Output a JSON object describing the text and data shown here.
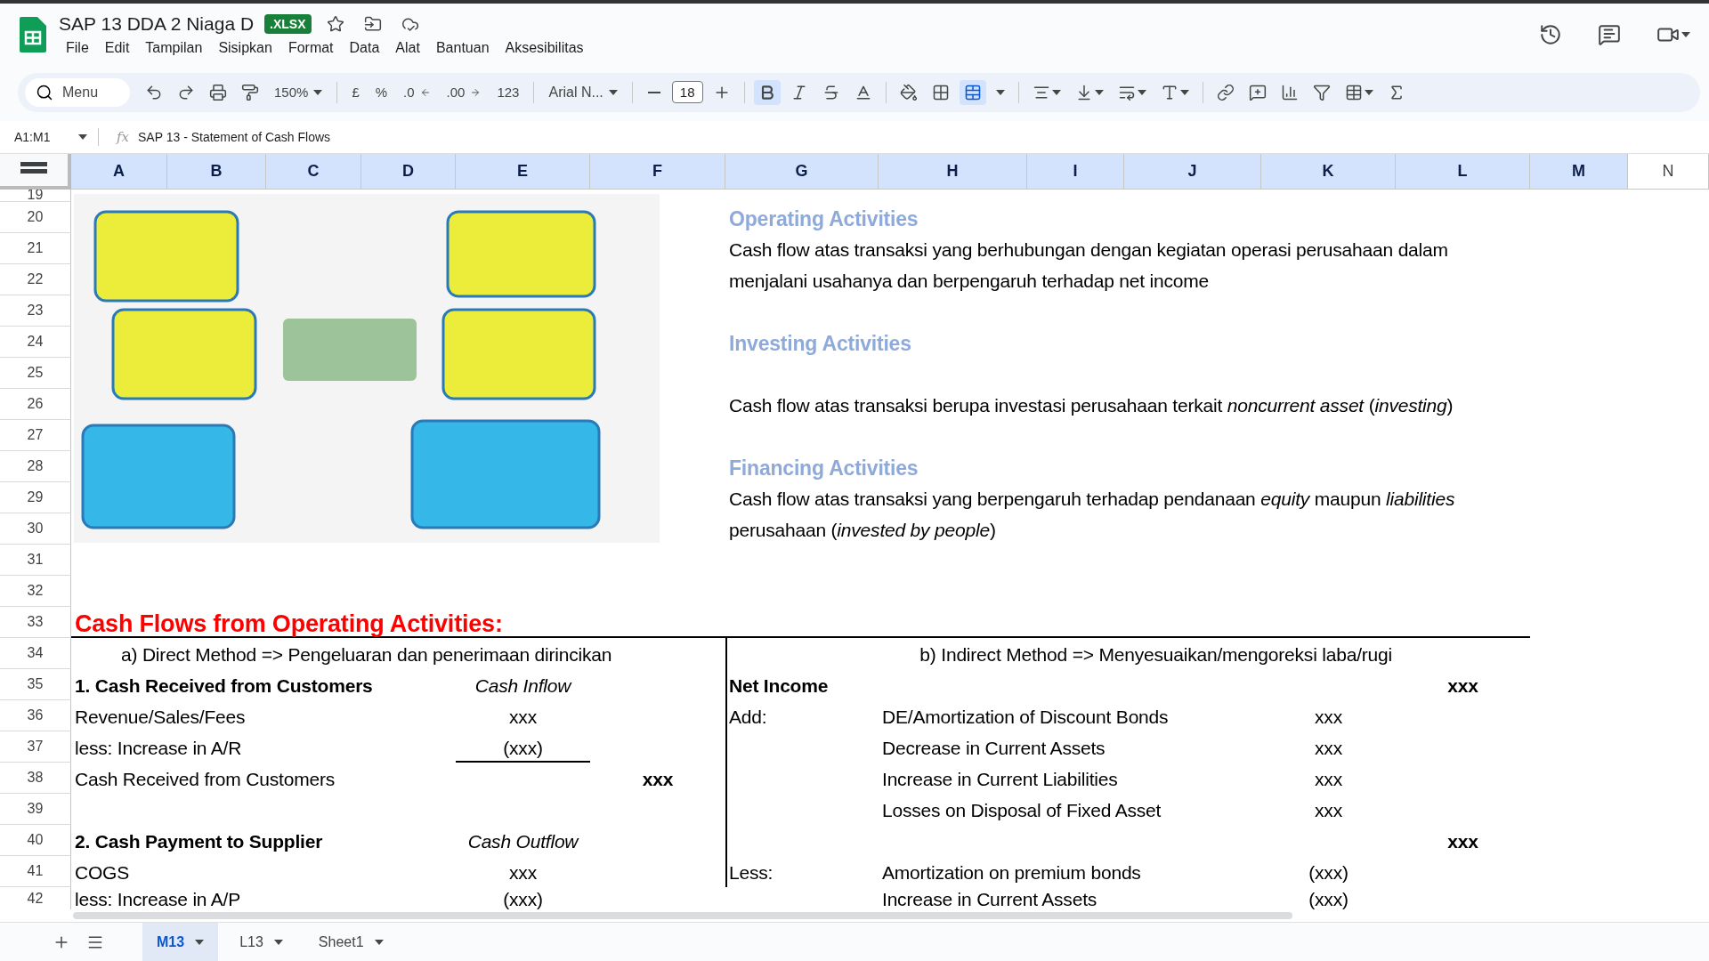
{
  "document": {
    "title": "SAP 13 DDA 2 Niaga D",
    "badge": ".XLSX",
    "starred": false
  },
  "menu": [
    "File",
    "Edit",
    "Tampilan",
    "Sisipkan",
    "Format",
    "Data",
    "Alat",
    "Bantuan",
    "Aksesibilitas"
  ],
  "toolbar": {
    "search_placeholder": "Menu",
    "zoom": "150%",
    "currency": "£",
    "percent": "%",
    "decrease_decimals": ".0",
    "increase_decimals": ".00",
    "number_format": "123",
    "font": "Arial N...",
    "font_size": "18",
    "bold_active": true,
    "merge_active": true
  },
  "formula_bar": {
    "name_box": "A1:M1",
    "fx": "fx",
    "formula": "SAP 13 - Statement of Cash Flows"
  },
  "columns": [
    {
      "label": "A",
      "selected": true
    },
    {
      "label": "B",
      "selected": true
    },
    {
      "label": "C",
      "selected": true
    },
    {
      "label": "D",
      "selected": true
    },
    {
      "label": "E",
      "selected": true
    },
    {
      "label": "F",
      "selected": true
    },
    {
      "label": "G",
      "selected": true
    },
    {
      "label": "H",
      "selected": true
    },
    {
      "label": "I",
      "selected": true
    },
    {
      "label": "J",
      "selected": true
    },
    {
      "label": "K",
      "selected": true
    },
    {
      "label": "L",
      "selected": true
    },
    {
      "label": "M",
      "selected": true
    },
    {
      "label": "N",
      "selected": false
    }
  ],
  "rows": [
    {
      "number": "19",
      "cells": {}
    },
    {
      "number": "20",
      "cells": {
        "G": {
          "kind": "heading",
          "text": "Operating Activities"
        }
      }
    },
    {
      "number": "21",
      "cells": {
        "G": {
          "kind": "text",
          "text": "Cash flow atas transaksi yang berhubungan dengan kegiatan operasi perusahaan dalam"
        }
      }
    },
    {
      "number": "22",
      "cells": {
        "G": {
          "kind": "text",
          "text": "menjalani usahanya dan berpengaruh terhadap net income"
        }
      }
    },
    {
      "number": "23",
      "cells": {}
    },
    {
      "number": "24",
      "cells": {
        "G": {
          "kind": "heading",
          "text": "Investing Activities"
        }
      }
    },
    {
      "number": "25",
      "cells": {}
    },
    {
      "number": "26",
      "cells": {
        "G": {
          "kind": "text",
          "text": "Cash flow atas transaksi berupa investasi perusahaan terkait *noncurrent asset* (*investing*)"
        }
      }
    },
    {
      "number": "27",
      "cells": {}
    },
    {
      "number": "28",
      "cells": {
        "G": {
          "kind": "heading",
          "text": "Financing Activities"
        }
      }
    },
    {
      "number": "29",
      "cells": {
        "G": {
          "kind": "text",
          "text": "Cash flow atas transaksi yang berpengaruh terhadap pendanaan *equity* maupun *liabilities*"
        }
      }
    },
    {
      "number": "30",
      "cells": {
        "G": {
          "kind": "text",
          "text": "perusahaan (*invested by people*)"
        }
      }
    },
    {
      "number": "31",
      "cells": {}
    },
    {
      "number": "32",
      "cells": {}
    },
    {
      "number": "33",
      "cells": {
        "A": {
          "kind": "title",
          "text": "Cash Flows from Operating Activities:"
        }
      }
    },
    {
      "number": "34",
      "cells": {
        "A": {
          "kind": "subheading",
          "text": "a) Direct Method => Pengeluaran dan penerimaan dirincikan"
        },
        "G": {
          "kind": "subheading-right",
          "text": "b) Indirect Method => Menyesuaikan/mengoreksi laba/rugi"
        }
      }
    },
    {
      "number": "35",
      "cells": {
        "A": {
          "kind": "bold",
          "text": "1. Cash Received from Customers"
        },
        "E": {
          "kind": "center-italic",
          "text": "Cash Inflow"
        },
        "G": {
          "kind": "bold",
          "text": "Net Income"
        },
        "L": {
          "kind": "center-bold",
          "text": "xxx"
        }
      }
    },
    {
      "number": "36",
      "cells": {
        "A": {
          "kind": "text",
          "text": "Revenue/Sales/Fees"
        },
        "E": {
          "kind": "center",
          "text": "xxx"
        },
        "G": {
          "kind": "text",
          "text": "Add:"
        },
        "H": {
          "kind": "text",
          "text": "DE/Amortization of Discount Bonds"
        },
        "K": {
          "kind": "center",
          "text": "xxx"
        }
      }
    },
    {
      "number": "37",
      "cells": {
        "A": {
          "kind": "text",
          "text": "less: Increase in A/R"
        },
        "E": {
          "kind": "center",
          "underlined": true,
          "text": "(xxx)"
        },
        "H": {
          "kind": "text",
          "text": "Decrease in Current Assets"
        },
        "K": {
          "kind": "center",
          "text": "xxx"
        }
      }
    },
    {
      "number": "38",
      "cells": {
        "A": {
          "kind": "text",
          "text": "Cash Received from Customers"
        },
        "F": {
          "kind": "center-bold",
          "text": "xxx"
        },
        "H": {
          "kind": "text",
          "text": "Increase in Current Liabilities"
        },
        "K": {
          "kind": "center",
          "text": "xxx"
        }
      }
    },
    {
      "number": "39",
      "cells": {
        "H": {
          "kind": "text",
          "text": "Losses on Disposal of Fixed Asset"
        },
        "K": {
          "kind": "center",
          "text": "xxx"
        }
      }
    },
    {
      "number": "40",
      "cells": {
        "A": {
          "kind": "bold",
          "text": "2. Cash Payment to Supplier"
        },
        "E": {
          "kind": "center-italic",
          "text": "Cash Outflow"
        },
        "L": {
          "kind": "center-bold",
          "text": "xxx"
        }
      }
    },
    {
      "number": "41",
      "cells": {
        "A": {
          "kind": "text",
          "text": "COGS"
        },
        "E": {
          "kind": "center",
          "text": "xxx"
        },
        "G": {
          "kind": "text",
          "text": "Less:"
        },
        "H": {
          "kind": "text",
          "text": "Amortization on premium bonds"
        },
        "K": {
          "kind": "center",
          "text": "(xxx)"
        }
      }
    },
    {
      "number": "42",
      "cells": {
        "A": {
          "kind": "text",
          "text": "less: Increase in A/P"
        },
        "E": {
          "kind": "center",
          "text": "(xxx)"
        },
        "H": {
          "kind": "text",
          "text": "Increase in Current Assets"
        },
        "K": {
          "kind": "center",
          "text": "(xxx)"
        }
      }
    }
  ],
  "sheets": [
    {
      "label": "M13",
      "selected": true
    },
    {
      "label": "L13",
      "selected": false
    },
    {
      "label": "Sheet1",
      "selected": false
    }
  ]
}
